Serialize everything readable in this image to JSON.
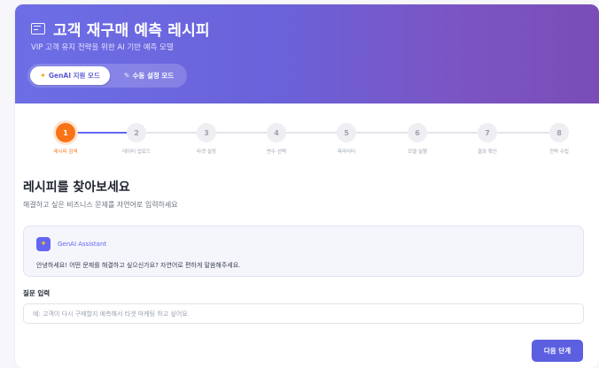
{
  "header": {
    "title": "고객 재구매 예측 레시피",
    "subtitle": "VIP 고객 유지 전략을 위한 AI 기반 예측 모델",
    "title_icon": "document-icon",
    "modes": [
      {
        "label": "GenAI 지원 모드",
        "icon": "sparkle-icon",
        "active": true
      },
      {
        "label": "수동 설정 모드",
        "icon": "pencil-icon",
        "active": false
      }
    ]
  },
  "stepper": {
    "current": 1,
    "accent_color": "#f97316",
    "steps": [
      {
        "number": "1",
        "label": "레시피 검색"
      },
      {
        "number": "2",
        "label": "데이터 업로드"
      },
      {
        "number": "3",
        "label": "타겟 설정"
      },
      {
        "number": "4",
        "label": "변수 선택"
      },
      {
        "number": "5",
        "label": "파라미터"
      },
      {
        "number": "6",
        "label": "모델 실행"
      },
      {
        "number": "7",
        "label": "결과 확인"
      },
      {
        "number": "8",
        "label": "전략 수립"
      }
    ]
  },
  "main": {
    "title": "레시피를 찾아보세요",
    "description": "해결하고 싶은 비즈니스 문제를 자연어로 입력하세요",
    "assistant": {
      "name": "GenAI Assistant",
      "icon": "sparkle-icon",
      "message": "안녕하세요! 어떤 문제를 해결하고 싶으신가요? 자연어로 편하게 말씀해주세요."
    },
    "question": {
      "label": "질문 입력",
      "value": "",
      "placeholder": "예: 고객이 다시 구매할지 예측해서 타겟 마케팅 하고 싶어요"
    },
    "next_label": "다음 단계"
  },
  "colors": {
    "brand": "#6366f1",
    "header_gradient_start": "#6d6ee6",
    "header_gradient_end": "#7a4db6",
    "active_step": "#f97316"
  }
}
